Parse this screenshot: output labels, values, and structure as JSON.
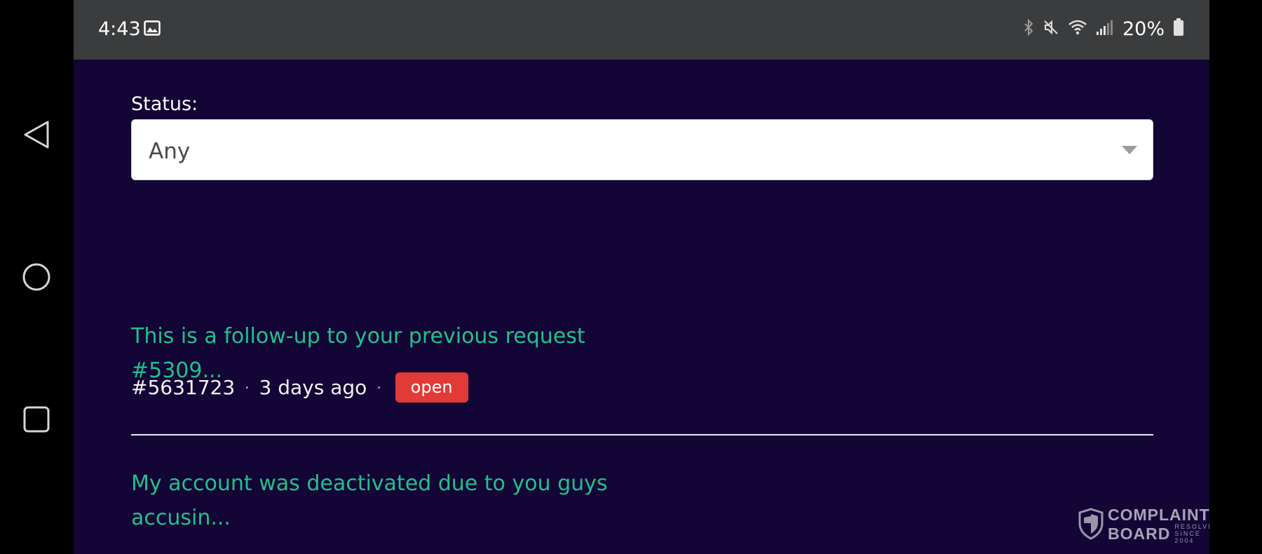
{
  "status_bar": {
    "time": "4:43",
    "battery_percent": "20%",
    "icons": [
      "gallery-icon",
      "bluetooth-icon",
      "mute-icon",
      "wifi-icon",
      "signal-icon",
      "battery-icon"
    ]
  },
  "nav_bar": {
    "icons": [
      "back-icon",
      "home-icon",
      "recents-icon"
    ]
  },
  "filter": {
    "label": "Status:",
    "selected": "Any"
  },
  "requests": [
    {
      "title": "This is a follow-up to your previous request #5309...",
      "id": "#5631723",
      "age": "3 days ago",
      "separator": "·",
      "status": "open"
    },
    {
      "title": "My account was deactivated due to you guys accusin..."
    }
  ],
  "watermark": {
    "line1": "COMPLAINTS",
    "line2": "BOARD",
    "tag1": "RESOLVING",
    "tag2": "SINCE 2004"
  },
  "colors": {
    "background": "#130536",
    "status_bar": "#3b3c3e",
    "link_green": "#22c08a",
    "badge_red": "#e23a36"
  }
}
